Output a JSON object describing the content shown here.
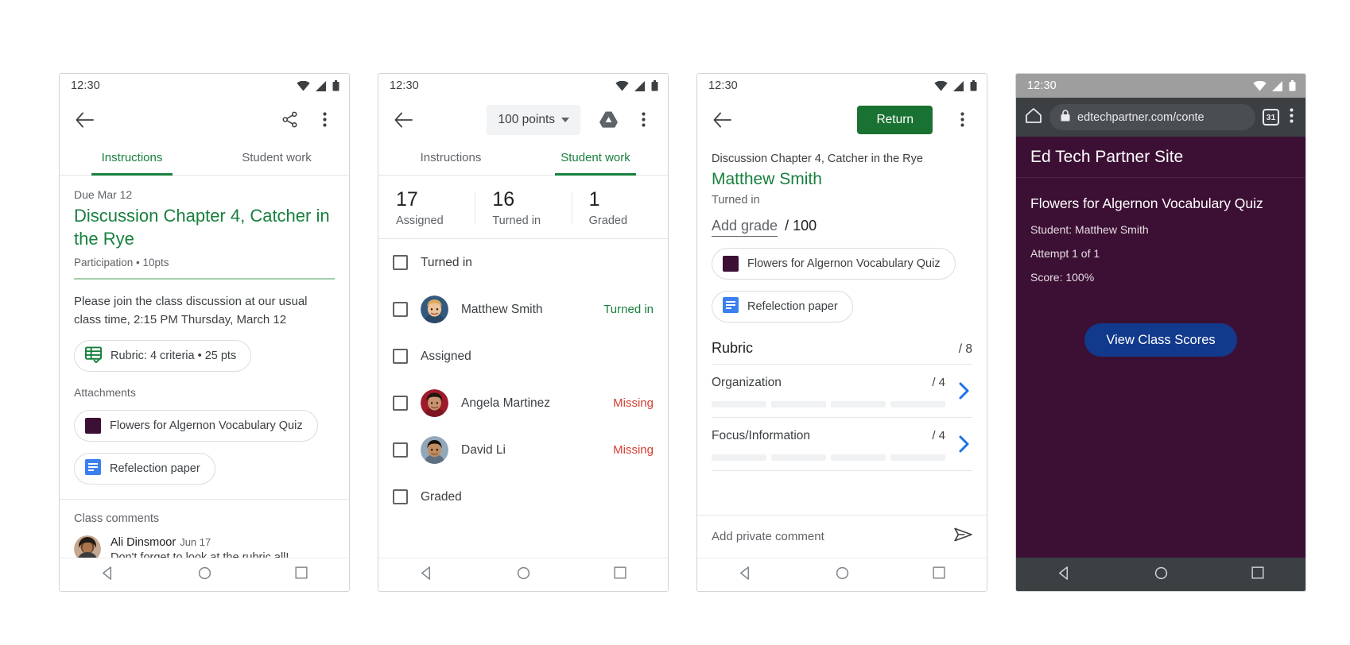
{
  "status": {
    "time": "12:30"
  },
  "phone1": {
    "toolbar": {
      "back": "back-arrow",
      "share": "share",
      "more": "more-options"
    },
    "tabs": [
      {
        "label": "Instructions",
        "active": true
      },
      {
        "label": "Student work",
        "active": false
      }
    ],
    "due": "Due Mar 12",
    "title": "Discussion Chapter 4, Catcher in the Rye",
    "meta": "Participation • 10pts",
    "description": "Please join the class discussion at our usual class time, 2:15 PM Thursday, March 12",
    "rubric_chip": "Rubric: 4 criteria • 25 pts",
    "attachments_label": "Attachments",
    "attachments": [
      {
        "label": "Flowers for Algernon Vocabulary Quiz",
        "icon": "purple-square-icon"
      },
      {
        "label": "Refelection paper",
        "icon": "blue-doc-icon"
      }
    ],
    "comments_label": "Class comments",
    "comment": {
      "author": "Ali Dinsmoor",
      "date": "Jun 17",
      "text": "Don't forget to look at the rubric all!"
    }
  },
  "phone2": {
    "points_chip": "100 points",
    "tabs": [
      {
        "label": "Instructions",
        "active": false
      },
      {
        "label": "Student work",
        "active": true
      }
    ],
    "stats": [
      {
        "num": "17",
        "cap": "Assigned"
      },
      {
        "num": "16",
        "cap": "Turned in"
      },
      {
        "num": "1",
        "cap": "Graded"
      }
    ],
    "rows": [
      {
        "type": "group",
        "label": "Turned in"
      },
      {
        "type": "student",
        "name": "Matthew Smith",
        "status": "Turned in",
        "statusColor": "green",
        "avatar": "matthew"
      },
      {
        "type": "group",
        "label": "Assigned"
      },
      {
        "type": "student",
        "name": "Angela Martinez",
        "status": "Missing",
        "statusColor": "red",
        "avatar": "angela"
      },
      {
        "type": "student",
        "name": "David Li",
        "status": "Missing",
        "statusColor": "red",
        "avatar": "david"
      },
      {
        "type": "group",
        "label": "Graded"
      }
    ]
  },
  "phone3": {
    "return_label": "Return",
    "assignment": "Discussion Chapter 4, Catcher in the Rye",
    "student": "Matthew Smith",
    "state": "Turned in",
    "grade_placeholder": "Add grade",
    "grade_total": "/ 100",
    "attachments": [
      {
        "label": "Flowers for Algernon Vocabulary Quiz",
        "icon": "purple-square-icon"
      },
      {
        "label": "Refelection paper",
        "icon": "blue-doc-icon"
      }
    ],
    "rubric_title": "Rubric",
    "rubric_total": "/ 8",
    "criteria": [
      {
        "name": "Organization",
        "score": "/ 4"
      },
      {
        "name": "Focus/Information",
        "score": "/ 4"
      }
    ],
    "private_comment_placeholder": "Add private comment"
  },
  "phone4": {
    "url": "edtechpartner.com/conte",
    "tab_count": "31",
    "site_title": "Ed Tech Partner Site",
    "page_heading": "Flowers for Algernon Vocabulary Quiz",
    "lines": [
      "Student: Matthew Smith",
      "Attempt 1 of 1",
      "Score: 100%"
    ],
    "cta": "View Class Scores"
  },
  "colors": {
    "green": "#17803d",
    "return_green": "#1a7232",
    "red": "#d23f31",
    "blue": "#3b7ff0",
    "purple": "#3c1034",
    "cta_blue": "#123a8c"
  }
}
